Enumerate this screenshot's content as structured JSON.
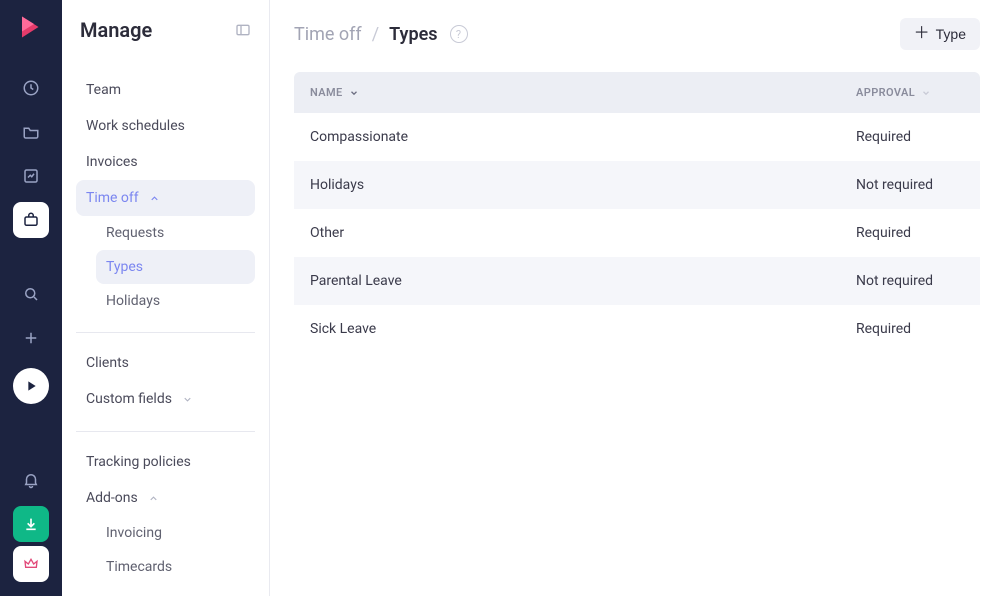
{
  "iconRail": {
    "logo": "logo",
    "items": [
      {
        "name": "clock-icon",
        "active": false
      },
      {
        "name": "folder-icon",
        "active": false
      },
      {
        "name": "image-icon",
        "active": false
      },
      {
        "name": "briefcase-icon",
        "active": true
      }
    ],
    "secondary": [
      {
        "name": "search-icon"
      },
      {
        "name": "plus-icon"
      }
    ],
    "playCircle": "play-icon",
    "bottom": [
      {
        "name": "bell-icon",
        "style": "plain"
      },
      {
        "name": "download-icon",
        "style": "green"
      },
      {
        "name": "crown-icon",
        "style": "white"
      }
    ]
  },
  "sidenav": {
    "title": "Manage",
    "groups": {
      "team": "Team",
      "workSchedules": "Work schedules",
      "invoices": "Invoices",
      "timeOff": "Time off",
      "timeOffSub": {
        "requests": "Requests",
        "types": "Types",
        "holidays": "Holidays"
      },
      "clients": "Clients",
      "customFields": "Custom fields",
      "trackingPolicies": "Tracking policies",
      "addOns": "Add-ons",
      "addOnsSub": {
        "invoicing": "Invoicing",
        "timecards": "Timecards"
      }
    }
  },
  "header": {
    "breadcrumbParent": "Time off",
    "breadcrumbCurrent": "Types",
    "addButton": "Type"
  },
  "table": {
    "columns": {
      "name": "Name",
      "approval": "Approval"
    },
    "rows": [
      {
        "name": "Compassionate",
        "approval": "Required"
      },
      {
        "name": "Holidays",
        "approval": "Not required"
      },
      {
        "name": "Other",
        "approval": "Required"
      },
      {
        "name": "Parental Leave",
        "approval": "Not required"
      },
      {
        "name": "Sick Leave",
        "approval": "Required"
      }
    ]
  }
}
